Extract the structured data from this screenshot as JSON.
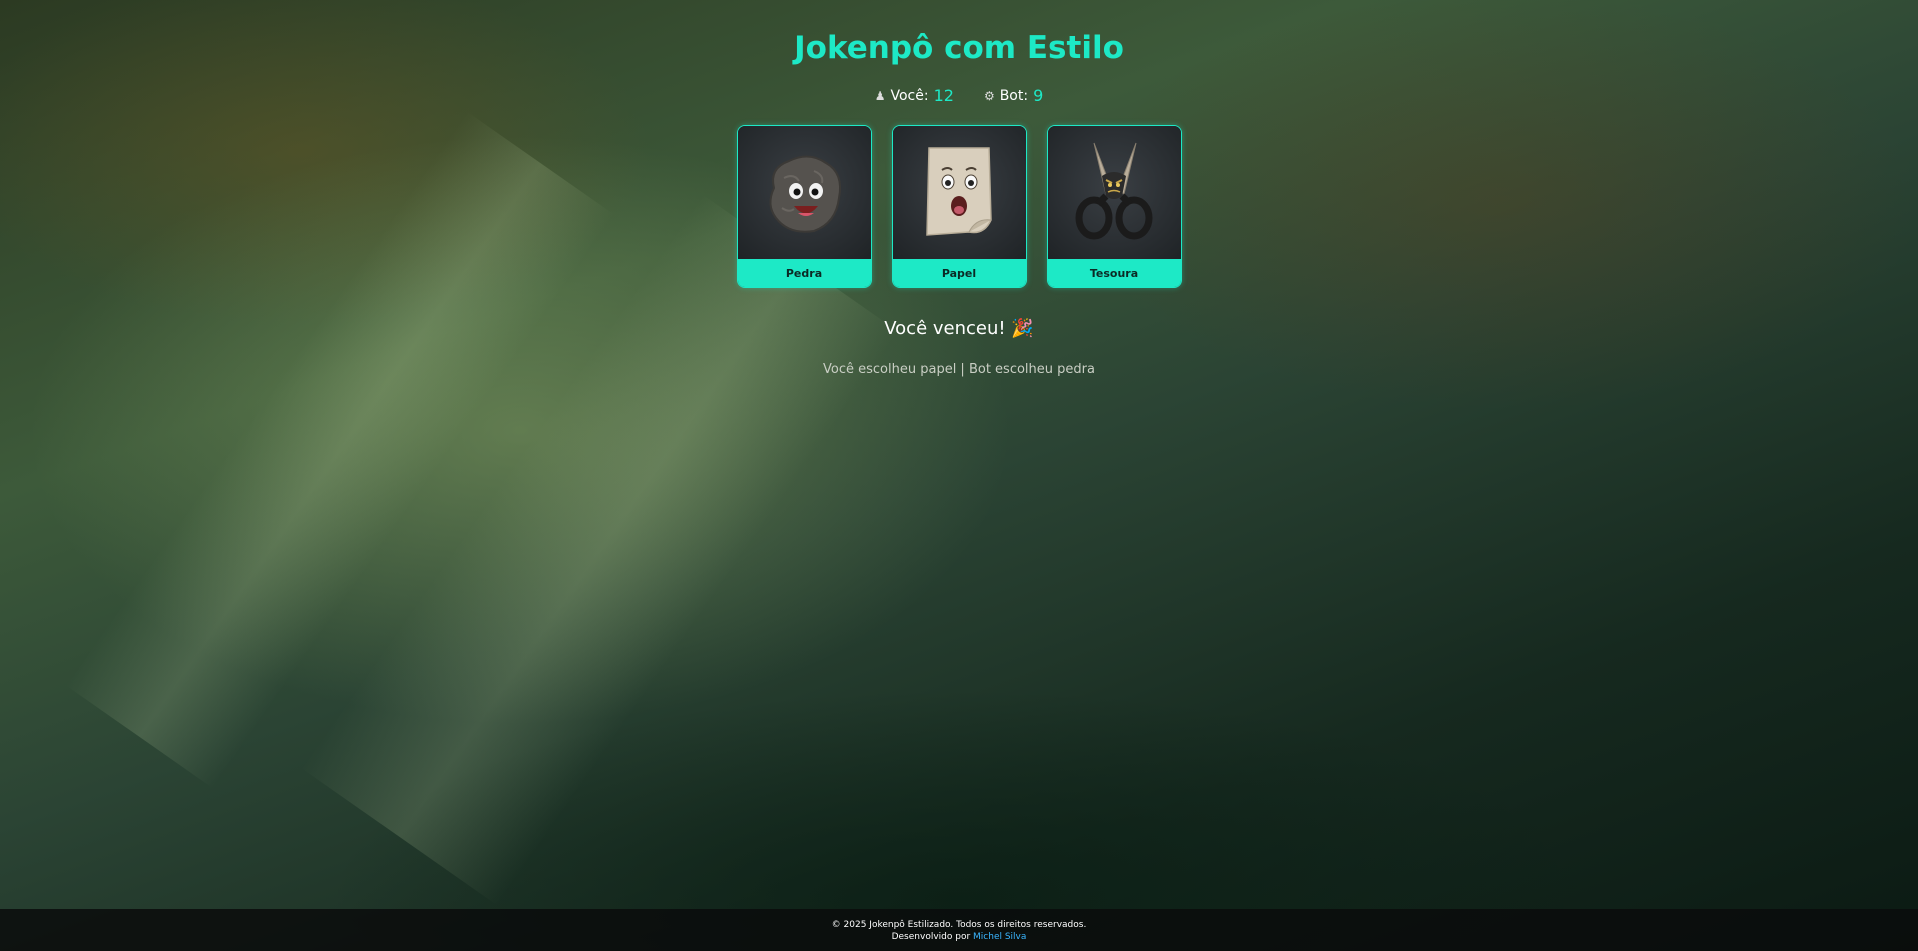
{
  "app": {
    "title": "Jokenpô com Estilo"
  },
  "score": {
    "player_label": "Você:",
    "player_value": "12",
    "bot_label": "Bot:",
    "bot_value": "9"
  },
  "choices": [
    {
      "label": "Pedra",
      "icon": "rock-face-icon"
    },
    {
      "label": "Papel",
      "icon": "paper-face-icon"
    },
    {
      "label": "Tesoura",
      "icon": "scissors-face-icon"
    }
  ],
  "result": {
    "message": "Você venceu! 🎉",
    "detail": "Você escolheu papel | Bot escolheu pedra"
  },
  "footer": {
    "copyright": "© 2025 Jokenpô Estilizado. Todos os direitos reservados.",
    "dev_prefix": "Desenvolvido por",
    "dev_name": "Michel Silva"
  },
  "colors": {
    "accent": "#1de9c6",
    "link": "#3ab6ff"
  }
}
